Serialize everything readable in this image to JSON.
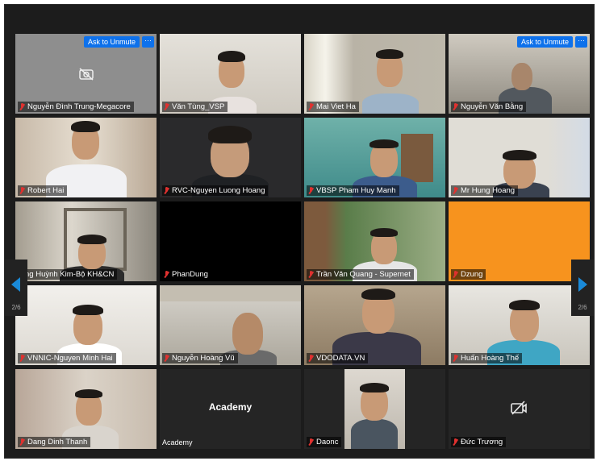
{
  "meeting": {
    "ask_to_unmute_label": "Ask to Unmute",
    "more_label": "···",
    "page_indicator": "2/6",
    "participants": [
      {
        "name": "Nguyễn Đình Trung-Megacore",
        "video_off": true,
        "ask_unmute": true
      },
      {
        "name": "Văn Tùng_VSP"
      },
      {
        "name": "Mai Viet Ha"
      },
      {
        "name": "Nguyễn Văn Bằng",
        "ask_unmute": true
      },
      {
        "name": "Robert Hai"
      },
      {
        "name": "RVC-Nguyen Luong Hoang"
      },
      {
        "name": "VBSP Pham Huy Manh"
      },
      {
        "name": "Mr Hung Hoang"
      },
      {
        "name": "ng Huỳnh Kim-Bộ KH&CN"
      },
      {
        "name": "PhanDung"
      },
      {
        "name": "Trần Văn Quang - Supernet"
      },
      {
        "name": "Dzung"
      },
      {
        "name": "VNNIC-Nguyen Minh Hai"
      },
      {
        "name": "Nguyễn Hoàng Vũ"
      },
      {
        "name": "VDODATA.VN"
      },
      {
        "name": "Huấn Hoàng Thế"
      },
      {
        "name": "Dang  Dinh Thanh"
      },
      {
        "name": "Academy",
        "center_label": "Academy"
      },
      {
        "name": "Daonc"
      },
      {
        "name": "Đức Trương"
      }
    ]
  },
  "colors": {
    "unmute_blue": "#0e71eb",
    "mic_red": "#e0312f",
    "nav_arrow_blue": "#1a8ad8",
    "dzung_orange": "#f7931e"
  }
}
